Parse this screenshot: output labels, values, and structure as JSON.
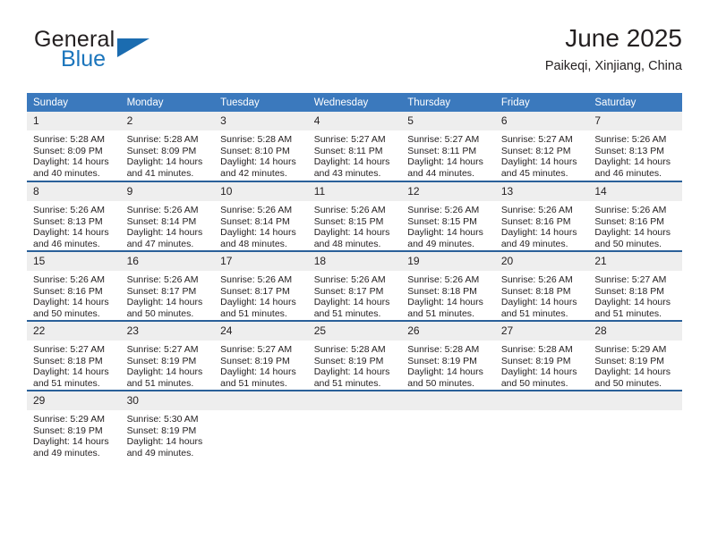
{
  "brand": {
    "name_top": "General",
    "name_bottom": "Blue",
    "accent_color": "#1b75bc",
    "triangle_color": "#1b6cb0"
  },
  "header": {
    "title": "June 2025",
    "subtitle": "Paikeqi, Xinjiang, China"
  },
  "theme": {
    "header_bg": "#3b79bd",
    "row_rule": "#2a6099",
    "daynum_bg": "#eeeeee",
    "text": "#231f20"
  },
  "weekdays": [
    "Sunday",
    "Monday",
    "Tuesday",
    "Wednesday",
    "Thursday",
    "Friday",
    "Saturday"
  ],
  "weeks": [
    [
      {
        "day": "1",
        "sunrise": "Sunrise: 5:28 AM",
        "sunset": "Sunset: 8:09 PM",
        "daylight1": "Daylight: 14 hours",
        "daylight2": "and 40 minutes."
      },
      {
        "day": "2",
        "sunrise": "Sunrise: 5:28 AM",
        "sunset": "Sunset: 8:09 PM",
        "daylight1": "Daylight: 14 hours",
        "daylight2": "and 41 minutes."
      },
      {
        "day": "3",
        "sunrise": "Sunrise: 5:28 AM",
        "sunset": "Sunset: 8:10 PM",
        "daylight1": "Daylight: 14 hours",
        "daylight2": "and 42 minutes."
      },
      {
        "day": "4",
        "sunrise": "Sunrise: 5:27 AM",
        "sunset": "Sunset: 8:11 PM",
        "daylight1": "Daylight: 14 hours",
        "daylight2": "and 43 minutes."
      },
      {
        "day": "5",
        "sunrise": "Sunrise: 5:27 AM",
        "sunset": "Sunset: 8:11 PM",
        "daylight1": "Daylight: 14 hours",
        "daylight2": "and 44 minutes."
      },
      {
        "day": "6",
        "sunrise": "Sunrise: 5:27 AM",
        "sunset": "Sunset: 8:12 PM",
        "daylight1": "Daylight: 14 hours",
        "daylight2": "and 45 minutes."
      },
      {
        "day": "7",
        "sunrise": "Sunrise: 5:26 AM",
        "sunset": "Sunset: 8:13 PM",
        "daylight1": "Daylight: 14 hours",
        "daylight2": "and 46 minutes."
      }
    ],
    [
      {
        "day": "8",
        "sunrise": "Sunrise: 5:26 AM",
        "sunset": "Sunset: 8:13 PM",
        "daylight1": "Daylight: 14 hours",
        "daylight2": "and 46 minutes."
      },
      {
        "day": "9",
        "sunrise": "Sunrise: 5:26 AM",
        "sunset": "Sunset: 8:14 PM",
        "daylight1": "Daylight: 14 hours",
        "daylight2": "and 47 minutes."
      },
      {
        "day": "10",
        "sunrise": "Sunrise: 5:26 AM",
        "sunset": "Sunset: 8:14 PM",
        "daylight1": "Daylight: 14 hours",
        "daylight2": "and 48 minutes."
      },
      {
        "day": "11",
        "sunrise": "Sunrise: 5:26 AM",
        "sunset": "Sunset: 8:15 PM",
        "daylight1": "Daylight: 14 hours",
        "daylight2": "and 48 minutes."
      },
      {
        "day": "12",
        "sunrise": "Sunrise: 5:26 AM",
        "sunset": "Sunset: 8:15 PM",
        "daylight1": "Daylight: 14 hours",
        "daylight2": "and 49 minutes."
      },
      {
        "day": "13",
        "sunrise": "Sunrise: 5:26 AM",
        "sunset": "Sunset: 8:16 PM",
        "daylight1": "Daylight: 14 hours",
        "daylight2": "and 49 minutes."
      },
      {
        "day": "14",
        "sunrise": "Sunrise: 5:26 AM",
        "sunset": "Sunset: 8:16 PM",
        "daylight1": "Daylight: 14 hours",
        "daylight2": "and 50 minutes."
      }
    ],
    [
      {
        "day": "15",
        "sunrise": "Sunrise: 5:26 AM",
        "sunset": "Sunset: 8:16 PM",
        "daylight1": "Daylight: 14 hours",
        "daylight2": "and 50 minutes."
      },
      {
        "day": "16",
        "sunrise": "Sunrise: 5:26 AM",
        "sunset": "Sunset: 8:17 PM",
        "daylight1": "Daylight: 14 hours",
        "daylight2": "and 50 minutes."
      },
      {
        "day": "17",
        "sunrise": "Sunrise: 5:26 AM",
        "sunset": "Sunset: 8:17 PM",
        "daylight1": "Daylight: 14 hours",
        "daylight2": "and 51 minutes."
      },
      {
        "day": "18",
        "sunrise": "Sunrise: 5:26 AM",
        "sunset": "Sunset: 8:17 PM",
        "daylight1": "Daylight: 14 hours",
        "daylight2": "and 51 minutes."
      },
      {
        "day": "19",
        "sunrise": "Sunrise: 5:26 AM",
        "sunset": "Sunset: 8:18 PM",
        "daylight1": "Daylight: 14 hours",
        "daylight2": "and 51 minutes."
      },
      {
        "day": "20",
        "sunrise": "Sunrise: 5:26 AM",
        "sunset": "Sunset: 8:18 PM",
        "daylight1": "Daylight: 14 hours",
        "daylight2": "and 51 minutes."
      },
      {
        "day": "21",
        "sunrise": "Sunrise: 5:27 AM",
        "sunset": "Sunset: 8:18 PM",
        "daylight1": "Daylight: 14 hours",
        "daylight2": "and 51 minutes."
      }
    ],
    [
      {
        "day": "22",
        "sunrise": "Sunrise: 5:27 AM",
        "sunset": "Sunset: 8:18 PM",
        "daylight1": "Daylight: 14 hours",
        "daylight2": "and 51 minutes."
      },
      {
        "day": "23",
        "sunrise": "Sunrise: 5:27 AM",
        "sunset": "Sunset: 8:19 PM",
        "daylight1": "Daylight: 14 hours",
        "daylight2": "and 51 minutes."
      },
      {
        "day": "24",
        "sunrise": "Sunrise: 5:27 AM",
        "sunset": "Sunset: 8:19 PM",
        "daylight1": "Daylight: 14 hours",
        "daylight2": "and 51 minutes."
      },
      {
        "day": "25",
        "sunrise": "Sunrise: 5:28 AM",
        "sunset": "Sunset: 8:19 PM",
        "daylight1": "Daylight: 14 hours",
        "daylight2": "and 51 minutes."
      },
      {
        "day": "26",
        "sunrise": "Sunrise: 5:28 AM",
        "sunset": "Sunset: 8:19 PM",
        "daylight1": "Daylight: 14 hours",
        "daylight2": "and 50 minutes."
      },
      {
        "day": "27",
        "sunrise": "Sunrise: 5:28 AM",
        "sunset": "Sunset: 8:19 PM",
        "daylight1": "Daylight: 14 hours",
        "daylight2": "and 50 minutes."
      },
      {
        "day": "28",
        "sunrise": "Sunrise: 5:29 AM",
        "sunset": "Sunset: 8:19 PM",
        "daylight1": "Daylight: 14 hours",
        "daylight2": "and 50 minutes."
      }
    ],
    [
      {
        "day": "29",
        "sunrise": "Sunrise: 5:29 AM",
        "sunset": "Sunset: 8:19 PM",
        "daylight1": "Daylight: 14 hours",
        "daylight2": "and 49 minutes."
      },
      {
        "day": "30",
        "sunrise": "Sunrise: 5:30 AM",
        "sunset": "Sunset: 8:19 PM",
        "daylight1": "Daylight: 14 hours",
        "daylight2": "and 49 minutes."
      },
      {
        "day": "",
        "sunrise": "",
        "sunset": "",
        "daylight1": "",
        "daylight2": ""
      },
      {
        "day": "",
        "sunrise": "",
        "sunset": "",
        "daylight1": "",
        "daylight2": ""
      },
      {
        "day": "",
        "sunrise": "",
        "sunset": "",
        "daylight1": "",
        "daylight2": ""
      },
      {
        "day": "",
        "sunrise": "",
        "sunset": "",
        "daylight1": "",
        "daylight2": ""
      },
      {
        "day": "",
        "sunrise": "",
        "sunset": "",
        "daylight1": "",
        "daylight2": ""
      }
    ]
  ]
}
